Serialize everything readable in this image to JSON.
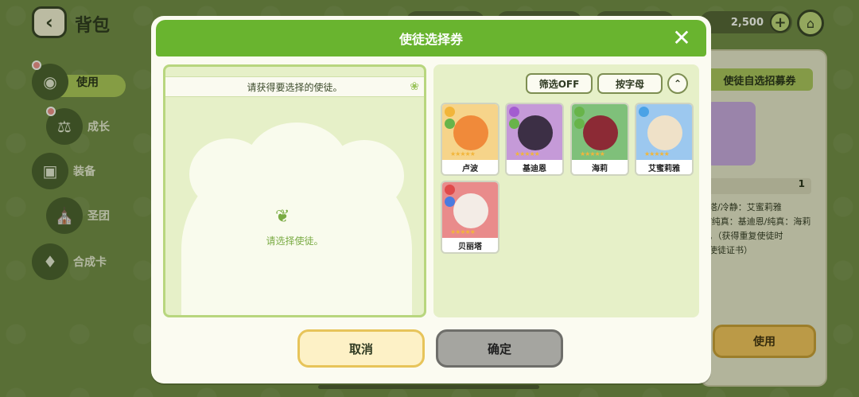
{
  "screen": {
    "title": "背包",
    "back_icon": "chevron-left-icon"
  },
  "topbar": {
    "currency_value": "2,500",
    "plus_icon": "plus-icon",
    "home_icon": "home-icon"
  },
  "sidebar": {
    "items": [
      {
        "label": "使用",
        "icon": "pot-icon",
        "active": true
      },
      {
        "label": "成长",
        "icon": "potion-icon",
        "active": false
      },
      {
        "label": "装备",
        "icon": "bag-icon",
        "active": false
      },
      {
        "label": "圣团",
        "icon": "gate-icon",
        "active": false
      },
      {
        "label": "合成卡",
        "icon": "cards-icon",
        "active": false
      }
    ]
  },
  "right_panel": {
    "title": "使徒自选招募券",
    "count": "1",
    "description": "丽塔/冷静：艾蜜莉雅\n恩/纯真：基迪恩/纯真：海莉\n得。（获得重复使徒时\n的使徒证书）",
    "use_label": "使用"
  },
  "modal": {
    "title": "使徒选择券",
    "close_icon": "close-icon",
    "hint": "请获得要选择的使徒。",
    "empty_text": "请选择使徒。",
    "filter_label": "筛选OFF",
    "sort_label": "按字母",
    "collapse_icon": "double-chevron-up-icon",
    "cancel_label": "取消",
    "confirm_label": "确定",
    "apostles": [
      {
        "name": "卢波",
        "bg": "#f6d48a",
        "hair": "#f08a3a",
        "badge": "#f2b53a",
        "badge2": "#68b44a"
      },
      {
        "name": "基迪恩",
        "bg": "#c59ad8",
        "hair": "#3c2f45",
        "badge": "#a35cd0",
        "badge2": "#68b44a"
      },
      {
        "name": "海莉",
        "bg": "#7fc07a",
        "hair": "#8c2a35",
        "badge": "#68b44a",
        "badge2": "#68b44a"
      },
      {
        "name": "艾蜜莉雅",
        "bg": "#9cc8ef",
        "hair": "#efe1c8",
        "badge": "#4aa2e6",
        "badge2": ""
      },
      {
        "name": "贝丽塔",
        "bg": "#e98b8b",
        "hair": "#f3ece6",
        "badge": "#e04a4a",
        "badge2": "#4a7be0"
      }
    ]
  }
}
